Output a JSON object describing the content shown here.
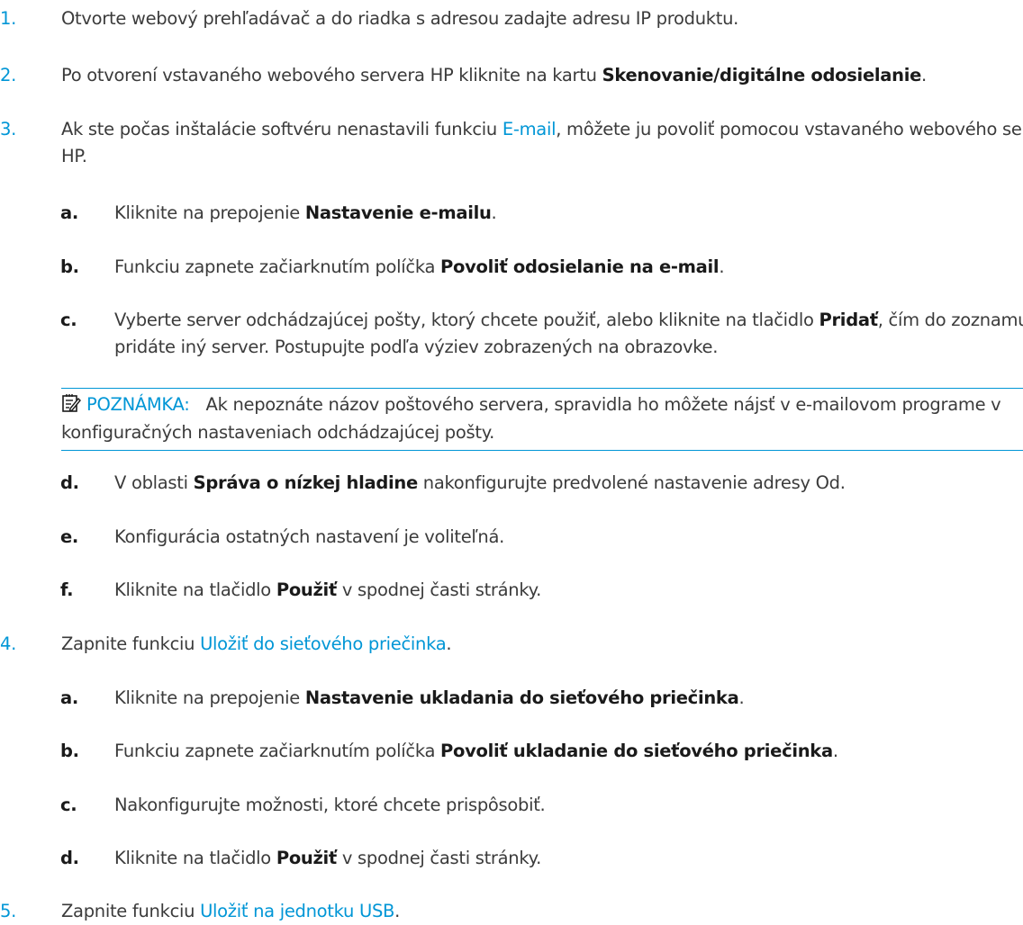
{
  "steps": [
    {
      "num": "1.",
      "text": "Otvorte webový prehľadávač a do riadka s adresou zadajte adresu IP produktu."
    },
    {
      "num": "2.",
      "pre": "Po otvorení vstavaného webového servera HP kliknite na kartu ",
      "bold": "Skenovanie/digitálne odosielanie",
      "post": "."
    },
    {
      "num": "3.",
      "pre": "Ak ste počas inštalácie softvéru nenastavili funkciu ",
      "link": "E-mail",
      "post": ", môžete ju povoliť pomocou vstavaného webového servera HP."
    },
    {
      "num": "4.",
      "pre": "Zapnite funkciu ",
      "link": "Uložiť do sieťového priečinka",
      "post": "."
    },
    {
      "num": "5.",
      "pre": "Zapnite funkciu ",
      "link": "Uložiť na jednotku USB",
      "post": "."
    }
  ],
  "email_substeps": [
    {
      "letter": "a.",
      "pre": "Kliknite na prepojenie ",
      "bold": "Nastavenie e-mailu",
      "post": "."
    },
    {
      "letter": "b.",
      "pre": "Funkciu zapnete začiarknutím políčka ",
      "bold": "Povoliť odosielanie na e-mail",
      "post": "."
    },
    {
      "letter": "c.",
      "pre": "Vyberte server odchádzajúcej pošty, ktorý chcete použiť, alebo kliknite na tlačidlo ",
      "bold": "Pridať",
      "post": ", čím do zoznamu pridáte iný server. Postupujte podľa výziev zobrazených na obrazovke."
    },
    {
      "letter": "d.",
      "pre": "V oblasti ",
      "bold": "Správa o nízkej hladine",
      "post": " nakonfigurujte predvolené nastavenie adresy Od."
    },
    {
      "letter": "e.",
      "pre": "Konfigurácia ostatných nastavení je voliteľná.",
      "bold": "",
      "post": ""
    },
    {
      "letter": "f.",
      "pre": "Kliknite na tlačidlo ",
      "bold": "Použiť",
      "post": " v spodnej časti stránky."
    }
  ],
  "note": {
    "icon": "note-icon",
    "label": "POZNÁMKA:",
    "text": "Ak nepoznáte názov poštového servera, spravidla ho môžete nájsť v e-mailovom programe v konfiguračných nastaveniach odchádzajúcej pošty."
  },
  "folder_substeps": [
    {
      "letter": "a.",
      "pre": "Kliknite na prepojenie ",
      "bold": "Nastavenie ukladania do sieťového priečinka",
      "post": "."
    },
    {
      "letter": "b.",
      "pre": "Funkciu zapnete začiarknutím políčka ",
      "bold": "Povoliť ukladanie do sieťového priečinka",
      "post": "."
    },
    {
      "letter": "c.",
      "pre": "Nakonfigurujte možnosti, ktoré chcete prispôsobiť.",
      "bold": "",
      "post": ""
    },
    {
      "letter": "d.",
      "pre": "Kliknite na tlačidlo ",
      "bold": "Použiť",
      "post": " v spodnej časti stránky."
    }
  ],
  "colors": {
    "accent": "#0096d6",
    "text": "#3b3b3b",
    "bold": "#1a1a1a"
  }
}
